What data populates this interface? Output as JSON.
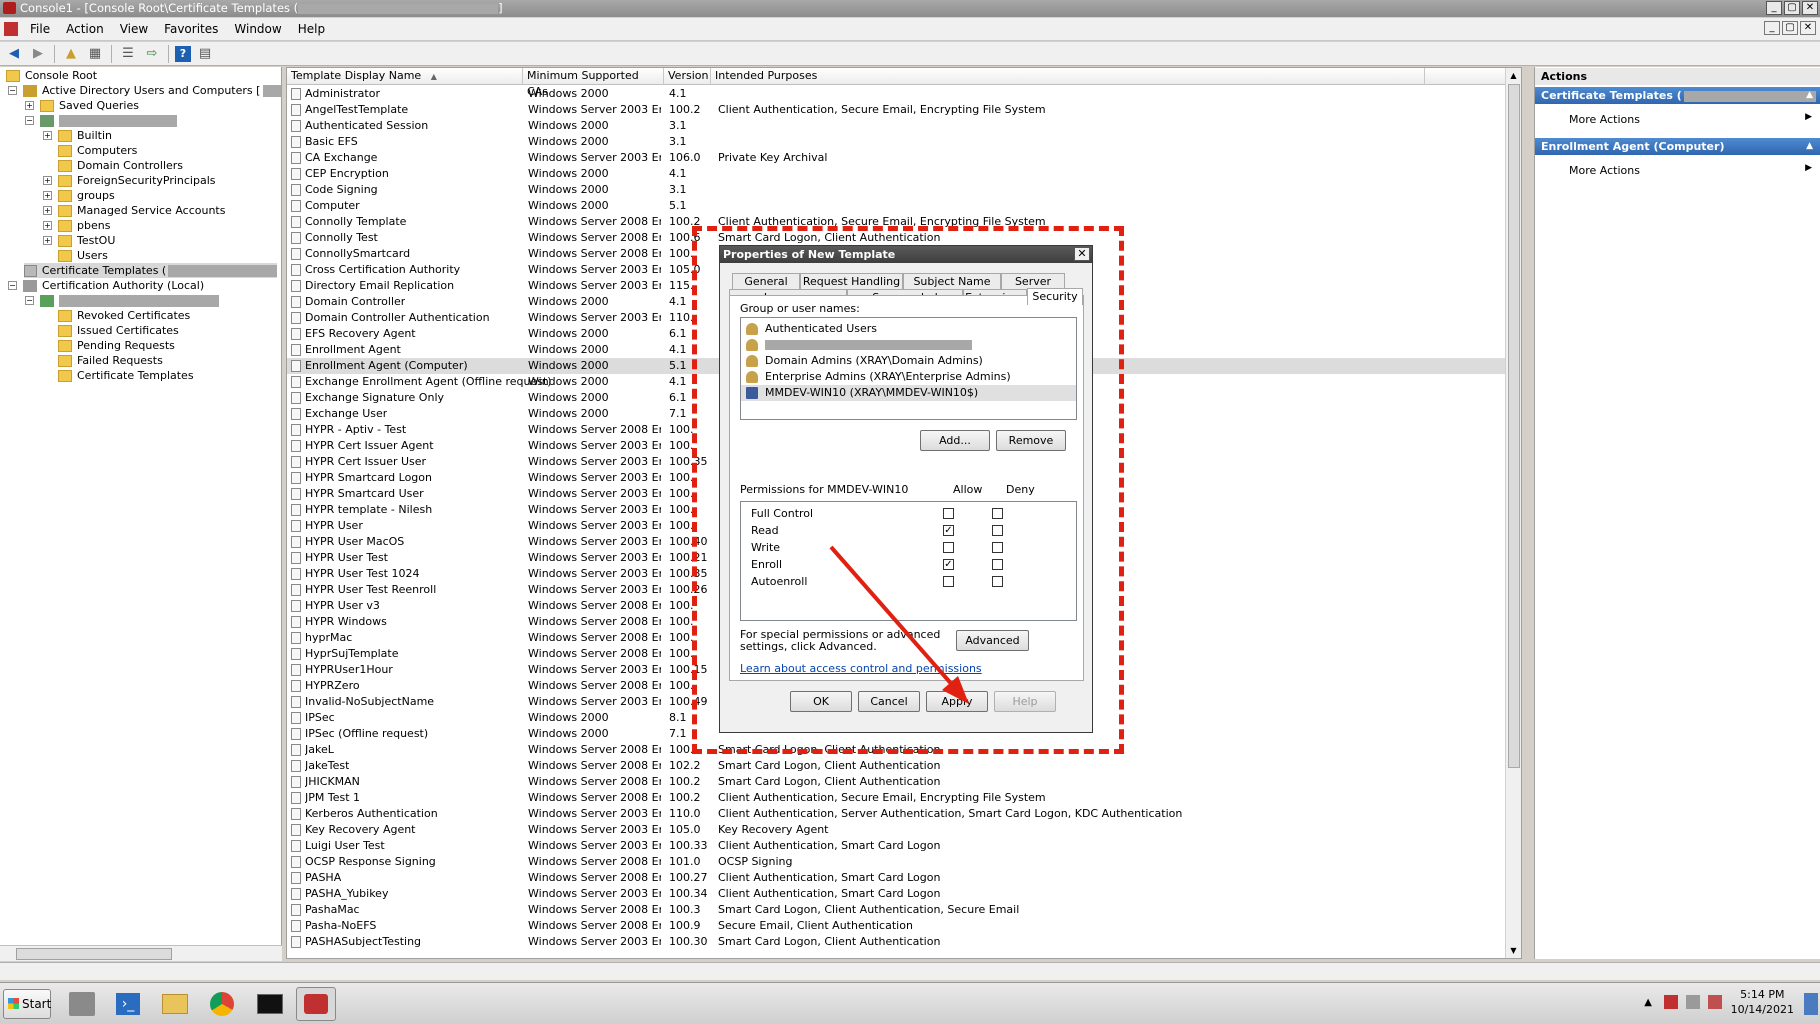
{
  "window": {
    "title": "Console1 - [Console Root\\Certificate Templates (",
    "title_suffix": "]",
    "controls": [
      "_",
      "▢",
      "✕"
    ]
  },
  "menu": {
    "items": [
      "File",
      "Action",
      "View",
      "Favorites",
      "Window",
      "Help"
    ]
  },
  "tree": {
    "root": "Console Root",
    "aduc": "Active Directory Users and Computers [",
    "saved_queries": "Saved Queries",
    "builtin": "Builtin",
    "computers": "Computers",
    "domain_controllers": "Domain Controllers",
    "fsp": "ForeignSecurityPrincipals",
    "groups": "groups",
    "msa": "Managed Service Accounts",
    "pbens": "pbens",
    "testou": "TestOU",
    "users": "Users",
    "cert_templates": "Certificate Templates (",
    "ca": "Certification Authority (Local)",
    "revoked": "Revoked Certificates",
    "issued": "Issued Certificates",
    "pending": "Pending Requests",
    "failed": "Failed Requests",
    "ca_templates": "Certificate Templates"
  },
  "list": {
    "columns": [
      "Template Display Name",
      "Minimum Supported CAs",
      "Version",
      "Intended Purposes"
    ],
    "sort_indicator": "▲",
    "rows": [
      [
        "Administrator",
        "Windows 2000",
        "4.1",
        ""
      ],
      [
        "AngelTestTemplate",
        "Windows Server 2003 Ent...",
        "100.2",
        "Client Authentication, Secure Email, Encrypting File System"
      ],
      [
        "Authenticated Session",
        "Windows 2000",
        "3.1",
        ""
      ],
      [
        "Basic EFS",
        "Windows 2000",
        "3.1",
        ""
      ],
      [
        "CA Exchange",
        "Windows Server 2003 Ent...",
        "106.0",
        "Private Key Archival"
      ],
      [
        "CEP Encryption",
        "Windows 2000",
        "4.1",
        ""
      ],
      [
        "Code Signing",
        "Windows 2000",
        "3.1",
        ""
      ],
      [
        "Computer",
        "Windows 2000",
        "5.1",
        ""
      ],
      [
        "Connolly Template",
        "Windows Server 2008 Ent...",
        "100.2",
        "Client Authentication, Secure Email, Encrypting File System"
      ],
      [
        "Connolly Test",
        "Windows Server 2008 Ent...",
        "100.6",
        "Smart Card Logon, Client Authentication"
      ],
      [
        "ConnollySmartcard",
        "Windows Server 2008 Ent...",
        "100.",
        ""
      ],
      [
        "Cross Certification Authority",
        "Windows Server 2003 Ent...",
        "105.0",
        ""
      ],
      [
        "Directory Email Replication",
        "Windows Server 2003 Ent...",
        "115.",
        ""
      ],
      [
        "Domain Controller",
        "Windows 2000",
        "4.1",
        ""
      ],
      [
        "Domain Controller Authentication",
        "Windows Server 2003 Ent...",
        "110.",
        ""
      ],
      [
        "EFS Recovery Agent",
        "Windows 2000",
        "6.1",
        ""
      ],
      [
        "Enrollment Agent",
        "Windows 2000",
        "4.1",
        ""
      ],
      [
        "Enrollment Agent (Computer)",
        "Windows 2000",
        "5.1",
        ""
      ],
      [
        "Exchange Enrollment Agent (Offline request)",
        "Windows 2000",
        "4.1",
        ""
      ],
      [
        "Exchange Signature Only",
        "Windows 2000",
        "6.1",
        ""
      ],
      [
        "Exchange User",
        "Windows 2000",
        "7.1",
        ""
      ],
      [
        "HYPR - Aptiv - Test",
        "Windows Server 2008 Ent...",
        "100.",
        ""
      ],
      [
        "HYPR Cert Issuer Agent",
        "Windows Server 2003 Ent...",
        "100.",
        ""
      ],
      [
        "HYPR Cert Issuer User",
        "Windows Server 2003 Ent...",
        "100.35",
        ""
      ],
      [
        "HYPR Smartcard Logon",
        "Windows Server 2003 Ent...",
        "100.",
        ""
      ],
      [
        "HYPR Smartcard User",
        "Windows Server 2003 Ent...",
        "100.",
        ""
      ],
      [
        "HYPR template - Nilesh",
        "Windows Server 2003 Ent...",
        "100.",
        ""
      ],
      [
        "HYPR User",
        "Windows Server 2003 Ent...",
        "100.",
        ""
      ],
      [
        "HYPR User MacOS",
        "Windows Server 2003 Ent...",
        "100.40",
        ""
      ],
      [
        "HYPR User Test",
        "Windows Server 2003 Ent...",
        "100.21",
        ""
      ],
      [
        "HYPR User Test 1024",
        "Windows Server 2003 Ent...",
        "100.35",
        ""
      ],
      [
        "HYPR User Test Reenroll",
        "Windows Server 2003 Ent...",
        "100.26",
        ""
      ],
      [
        "HYPR User v3",
        "Windows Server 2008 Ent...",
        "100.",
        ""
      ],
      [
        "HYPR Windows",
        "Windows Server 2008 Ent...",
        "100.",
        ""
      ],
      [
        "hyprMac",
        "Windows Server 2008 Ent...",
        "100.",
        ""
      ],
      [
        "HyprSujTemplate",
        "Windows Server 2008 Ent...",
        "100.",
        ""
      ],
      [
        "HYPRUser1Hour",
        "Windows Server 2003 Ent...",
        "100.15",
        ""
      ],
      [
        "HYPRZero",
        "Windows Server 2008 Ent...",
        "100.",
        ""
      ],
      [
        "Invalid-NoSubjectName",
        "Windows Server 2003 Ent...",
        "100.49",
        ""
      ],
      [
        "IPSec",
        "Windows 2000",
        "8.1",
        ""
      ],
      [
        "IPSec (Offline request)",
        "Windows 2000",
        "7.1",
        ""
      ],
      [
        "JakeL",
        "Windows Server 2008 Ent...",
        "100.",
        "Smart Card Logon, Client Authentication"
      ],
      [
        "JakeTest",
        "Windows Server 2008 Ent...",
        "102.2",
        "Smart Card Logon, Client Authentication"
      ],
      [
        "JHICKMAN",
        "Windows Server 2008 Ent...",
        "100.2",
        "Smart Card Logon, Client Authentication"
      ],
      [
        "JPM Test 1",
        "Windows Server 2008 Ent...",
        "100.2",
        "Client Authentication, Secure Email, Encrypting File System"
      ],
      [
        "Kerberos Authentication",
        "Windows Server 2003 Ent...",
        "110.0",
        "Client Authentication, Server Authentication, Smart Card Logon, KDC Authentication"
      ],
      [
        "Key Recovery Agent",
        "Windows Server 2003 Ent...",
        "105.0",
        "Key Recovery Agent"
      ],
      [
        "Luigi User Test",
        "Windows Server 2003 Ent...",
        "100.33",
        "Client Authentication, Smart Card Logon"
      ],
      [
        "OCSP Response Signing",
        "Windows Server 2008 Ent...",
        "101.0",
        "OCSP Signing"
      ],
      [
        "PASHA",
        "Windows Server 2008 Ent...",
        "100.27",
        "Client Authentication, Smart Card Logon"
      ],
      [
        "PASHA_Yubikey",
        "Windows Server 2003 Ent...",
        "100.34",
        "Client Authentication, Smart Card Logon"
      ],
      [
        "PashaMac",
        "Windows Server 2008 Ent...",
        "100.3",
        "Smart Card Logon, Client Authentication, Secure Email"
      ],
      [
        "Pasha-NoEFS",
        "Windows Server 2008 Ent...",
        "100.9",
        "Secure Email, Client Authentication"
      ],
      [
        "PASHASubjectTesting",
        "Windows Server 2003 Ent...",
        "100.30",
        "Smart Card Logon, Client Authentication"
      ]
    ]
  },
  "actions": {
    "title": "Actions",
    "section1": "Certificate Templates (",
    "more1": "More Actions",
    "section2": "Enrollment Agent (Computer)",
    "more2": "More Actions"
  },
  "dialog": {
    "title": "Properties of New Template",
    "close": "✕",
    "tabs_row1": [
      "General",
      "Request Handling",
      "Subject Name",
      "Server"
    ],
    "tabs_row2": [
      "Issuance Requirements",
      "Superseded Templates",
      "Extensions",
      "Security"
    ],
    "group_label": "Group or user names:",
    "users": [
      "Authenticated Users",
      "",
      "Domain Admins (XRAY\\Domain Admins)",
      "Enterprise Admins (XRAY\\Enterprise Admins)",
      "MMDEV-WIN10 (XRAY\\MMDEV-WIN10$)"
    ],
    "add": "Add...",
    "remove": "Remove",
    "perm_label": "Permissions for MMDEV-WIN10",
    "allow": "Allow",
    "deny": "Deny",
    "permissions": [
      {
        "name": "Full Control",
        "allow": false,
        "deny": false
      },
      {
        "name": "Read",
        "allow": true,
        "deny": false
      },
      {
        "name": "Write",
        "allow": false,
        "deny": false
      },
      {
        "name": "Enroll",
        "allow": true,
        "deny": false
      },
      {
        "name": "Autoenroll",
        "allow": false,
        "deny": false
      }
    ],
    "special_text": "For special permissions or advanced settings, click Advanced.",
    "advanced": "Advanced",
    "learn_link": "Learn about access control and permissions",
    "ok": "OK",
    "cancel": "Cancel",
    "apply": "Apply",
    "help": "Help"
  },
  "taskbar": {
    "start": "Start",
    "time": "5:14 PM",
    "date": "10/14/2021"
  },
  "colors": {
    "annotation": "#e02010",
    "header_blue": "#2f66b0"
  }
}
